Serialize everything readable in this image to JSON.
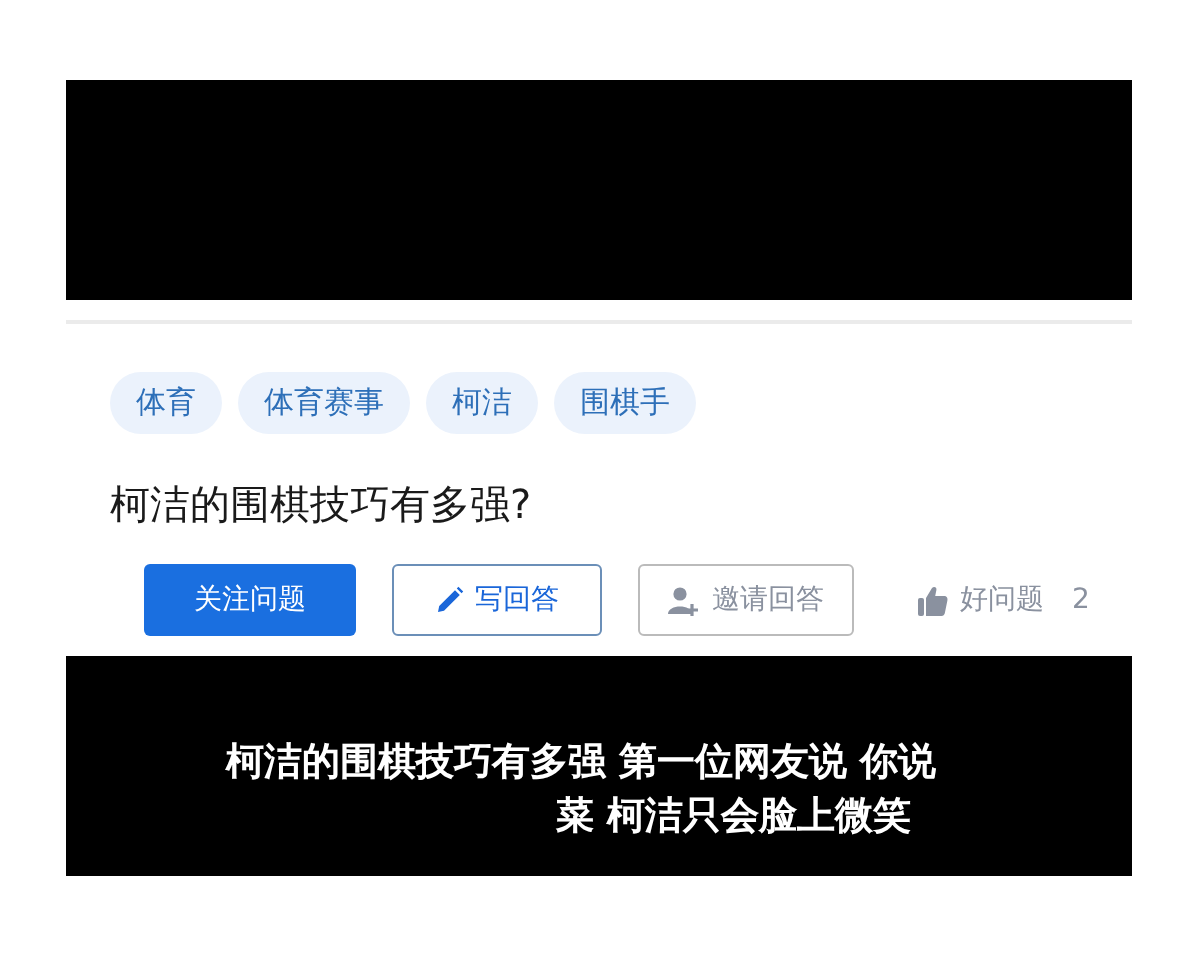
{
  "tags": [
    "体育",
    "体育赛事",
    "柯洁",
    "围棋手"
  ],
  "question": {
    "title": "柯洁的围棋技巧有多强?"
  },
  "actions": [
    {
      "kind": "primary",
      "label": "关注问题"
    },
    {
      "kind": "write",
      "label": "写回答"
    },
    {
      "kind": "invite",
      "label": "邀请回答"
    },
    {
      "kind": "like",
      "label": "好问题",
      "count": "2"
    }
  ],
  "video": {
    "subtitle_lines": [
      "柯洁的围棋技巧有多强 第一位网友说 你说",
      "菜 柯洁只会脸上微笑"
    ]
  }
}
